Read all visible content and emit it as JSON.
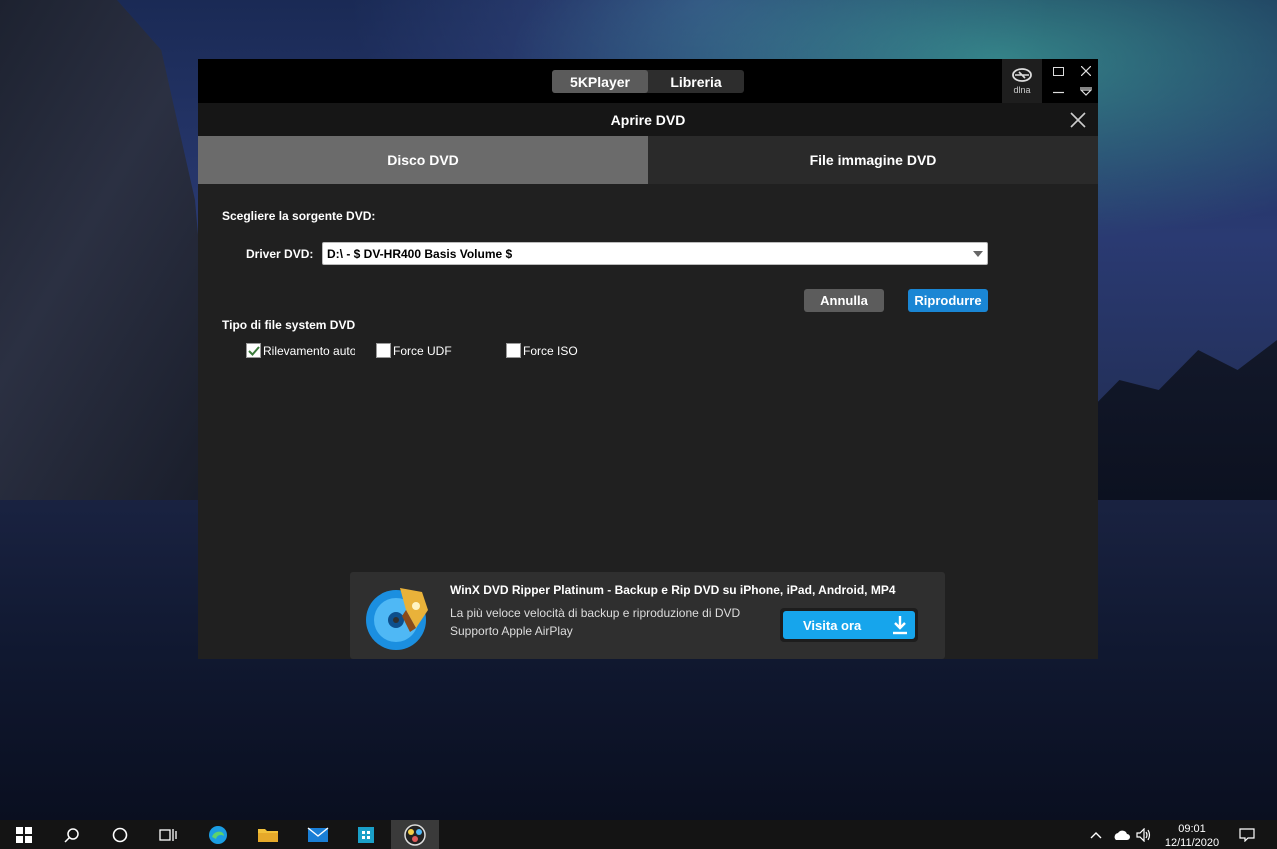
{
  "app": {
    "tabs": [
      "5KPlayer",
      "Libreria"
    ],
    "active_tab": "5KPlayer",
    "dlna_label": "dlna"
  },
  "dialog": {
    "title": "Aprire DVD",
    "tabs": [
      "Disco DVD",
      "File immagine DVD"
    ],
    "active_tab": "Disco DVD",
    "source_label": "Scegliere la sorgente DVD:",
    "driver_label": "Driver DVD:",
    "driver_value": "D:\\ - $ DV-HR400 Basis Volume $",
    "cancel_label": "Annulla",
    "play_label": "Riprodurre",
    "fs_label": "Tipo di file system DVD",
    "fs_options": [
      {
        "label": "Rilevamento auto",
        "checked": true
      },
      {
        "label": "Force UDF",
        "checked": false
      },
      {
        "label": "Force ISO",
        "checked": false
      }
    ]
  },
  "promo": {
    "title": "WinX DVD Ripper Platinum - Backup e Rip DVD su iPhone, iPad, Android, MP4",
    "line1": "La più veloce velocità di backup e riproduzione di DVD",
    "line2": "Supporto Apple AirPlay",
    "button_label": "Visita ora"
  },
  "taskbar": {
    "time": "09:01",
    "date": "12/11/2020"
  },
  "colors": {
    "accent": "#1a86d4",
    "promo_button": "#16a5ec"
  }
}
